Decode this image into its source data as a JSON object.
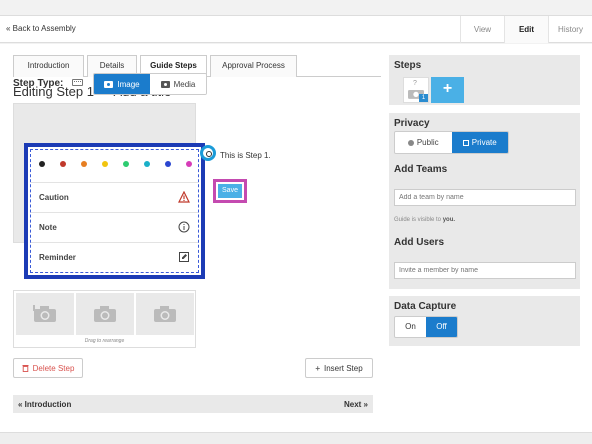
{
  "topbar": {
    "back_link": "« Back to Assembly",
    "tabs": [
      {
        "label": "View"
      },
      {
        "label": "Edit"
      },
      {
        "label": "History"
      }
    ]
  },
  "guide_tabs": [
    {
      "label": "Introduction"
    },
    {
      "label": "Details"
    },
    {
      "label": "Guide Steps"
    },
    {
      "label": "Approval Process"
    }
  ],
  "editing_title": "Editing Step 1 — Add a title",
  "step_type": {
    "label": "Step Type:",
    "options": [
      {
        "label": "Image"
      },
      {
        "label": "Media"
      }
    ]
  },
  "bullet_colors": [
    "#222222",
    "#c0392b",
    "#e67e22",
    "#f1c40f",
    "#2ecc71",
    "#1ab0c8",
    "#2b46d0",
    "#d63cb8"
  ],
  "bullet_menu": [
    {
      "label": "Caution",
      "icon": "caution-icon"
    },
    {
      "label": "Note",
      "icon": "info-icon"
    },
    {
      "label": "Reminder",
      "icon": "reminder-icon"
    }
  ],
  "bullet_text": "This is Step 1.",
  "save_label": "Save",
  "media": {
    "drag_hint": "Drag to rearrange"
  },
  "buttons": {
    "delete": "Delete Step",
    "insert": "Insert Step"
  },
  "pager": {
    "prev": "« Introduction",
    "next": "Next »"
  },
  "sidebar": {
    "steps": {
      "title": "Steps",
      "thumb_number": "1",
      "thumb_glyph": "?",
      "add_label": "+"
    },
    "privacy": {
      "title": "Privacy",
      "options": [
        {
          "label": "Public"
        },
        {
          "label": "Private"
        }
      ]
    },
    "teams": {
      "title": "Add Teams",
      "placeholder": "Add a team by name",
      "visibility_prefix": "Guide is visible to",
      "visibility_value": "you."
    },
    "users": {
      "title": "Add Users",
      "placeholder": "Invite a member by name"
    },
    "data_capture": {
      "title": "Data Capture",
      "options": [
        {
          "label": "On"
        },
        {
          "label": "Off"
        }
      ]
    }
  }
}
